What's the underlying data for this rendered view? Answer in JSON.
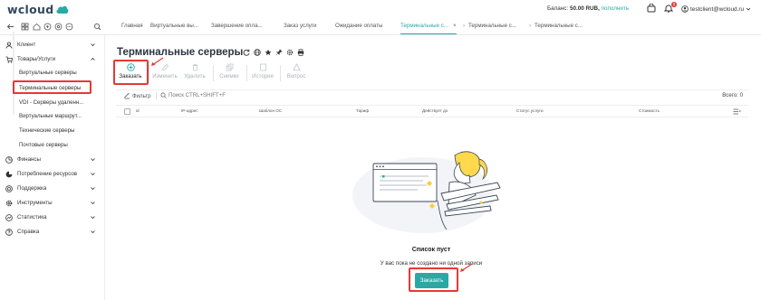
{
  "app": {
    "logo_text": "wcloud",
    "balance_label": "Баланс:",
    "balance_value": "50.00 RUB,",
    "topup_link": "пополнить",
    "notifications_count": "1",
    "user_email": "testclient@wcloud.ru",
    "colors": {
      "accent": "#2aa9a4",
      "highlight": "#e53935",
      "logo": "#34475a"
    }
  },
  "tabs": [
    {
      "label": "Главная"
    },
    {
      "label": "Виртуальные вы..."
    },
    {
      "label": "Завершение опла..."
    },
    {
      "label": "Заказ услуги"
    },
    {
      "label": "Ожидание оплаты"
    },
    {
      "label": "Терминальные с...",
      "active": true,
      "close": "×"
    },
    {
      "label": "Терминальные с..."
    },
    {
      "label": "Терминальные с..."
    }
  ],
  "sidebar": {
    "client": "Клиент",
    "goods": "Товары/Услуги",
    "sub_items": [
      "Виртуальные серверы",
      "Терминальные серверы",
      "VDI - Серверы удаленн...",
      "Виртуальные маршрут...",
      "Технические серверы",
      "Почтовые серверы"
    ],
    "sections": [
      "Финансы",
      "Потребление ресурсов",
      "Поддержка",
      "Инструменты",
      "Статистика",
      "Справка"
    ]
  },
  "page": {
    "title": "Терминальные серверы",
    "toolbar": {
      "order": "Заказать",
      "edit": "Изменить",
      "delete": "Удалить",
      "snapshots": "Снимки",
      "history": "История",
      "question": "Вопрос"
    },
    "filter_label": "Фильтр",
    "search_placeholder": "Поиск CTRL+SHIFT+F",
    "total": "Всего: 0",
    "columns": [
      "id",
      "IP-адрес",
      "Шаблон ОС",
      "Тариф",
      "Действует до",
      "Статус услуги",
      "Стоимость"
    ],
    "empty_title": "Список пуст",
    "empty_subtitle": "У вас пока не создано ни одной записи",
    "order_button": "Заказать"
  }
}
